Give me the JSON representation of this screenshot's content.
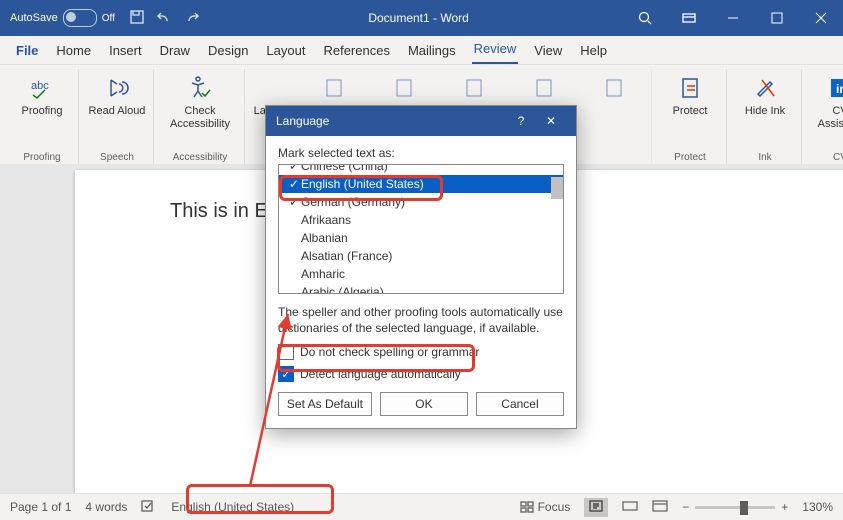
{
  "titlebar": {
    "autosave": "AutoSave",
    "toggle": "Off",
    "doc": "Document1 - Word"
  },
  "tabs": {
    "file": "File",
    "home": "Home",
    "insert": "Insert",
    "draw": "Draw",
    "design": "Design",
    "layout": "Layout",
    "references": "References",
    "mailings": "Mailings",
    "review": "Review",
    "view": "View",
    "help": "Help"
  },
  "ribbon": {
    "proofing": {
      "label": "Proofing",
      "btn": "Proofing"
    },
    "speech": {
      "label": "Speech",
      "btn": "Read\nAloud"
    },
    "accessibility": {
      "label": "Accessibility",
      "btn": "Check\nAccessibility"
    },
    "language": {
      "btn": "Langua"
    },
    "protect": {
      "label": "Protect",
      "btn": "Protect"
    },
    "ink": {
      "label": "Ink",
      "btn": "Hide\nInk"
    },
    "cv": {
      "label": "CV",
      "btn": "CV\nAssistant"
    }
  },
  "doc_text": "This is in E",
  "dialog": {
    "title": "Language",
    "mark": "Mark selected text as:",
    "items": [
      "Chinese (China)",
      "English (United States)",
      "German (Germany)",
      "Afrikaans",
      "Albanian",
      "Alsatian (France)",
      "Amharic",
      "Arabic (Algeria)"
    ],
    "selected": 1,
    "explain": "The speller and other proofing tools automatically use dictionaries of the selected language, if available.",
    "dont_check": "Do not check spelling or grammar",
    "detect": "Detect language automatically",
    "set_default": "Set As Default",
    "ok": "OK",
    "cancel": "Cancel"
  },
  "status": {
    "page": "Page 1 of 1",
    "words": "4 words",
    "lang": "English (United States)",
    "focus": "Focus",
    "zoom": "130%"
  }
}
